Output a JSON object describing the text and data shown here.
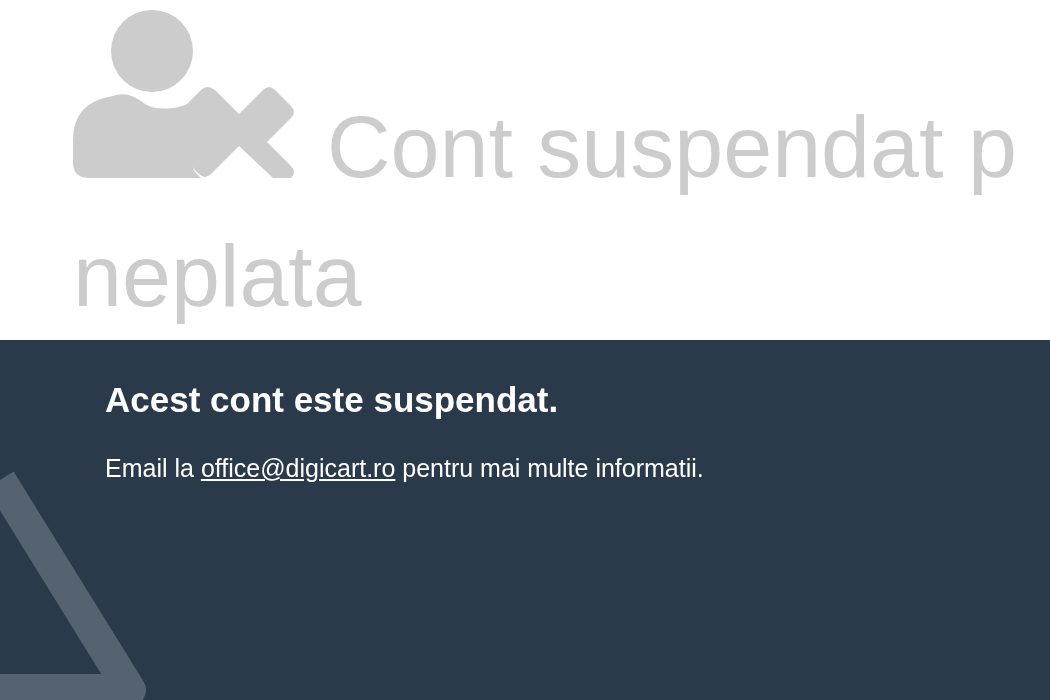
{
  "heading": {
    "lines": [
      "Cont suspendat p",
      "neplata"
    ]
  },
  "notice": {
    "title": "Acest cont este suspendat.",
    "text_before": "Email la",
    "link": "office@digicart.ro",
    "text_after": "pentru mai multe informatii."
  }
}
